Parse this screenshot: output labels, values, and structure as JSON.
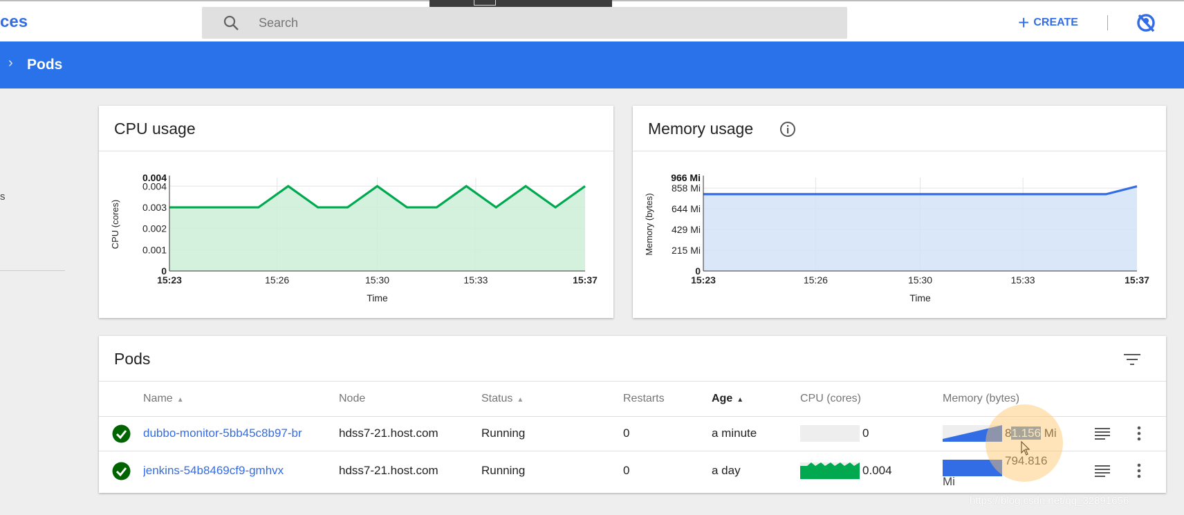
{
  "header": {
    "title_fragment": "ces",
    "search_placeholder": "Search",
    "create_label": "CREATE",
    "icons": {
      "search": "search-icon",
      "create": "plus-icon",
      "user": "account-off-icon"
    }
  },
  "breadcrumb": {
    "current": "Pods"
  },
  "sidebar": {
    "fragment": "s"
  },
  "colors": {
    "brand": "#326de6",
    "bar": "#2a72e9",
    "cpu": "#00a94f",
    "memory": "#326de6",
    "ok": "#006400"
  },
  "chart_data": [
    {
      "type": "area",
      "title": "CPU usage",
      "xlabel": "Time",
      "ylabel": "CPU (cores)",
      "x": [
        "15:23",
        "15:24",
        "15:25",
        "15:26",
        "15:27",
        "15:28",
        "15:29",
        "15:30",
        "15:31",
        "15:32",
        "15:33",
        "15:34",
        "15:35",
        "15:36",
        "15:37"
      ],
      "values": [
        0.003,
        0.003,
        0.003,
        0.003,
        0.004,
        0.003,
        0.003,
        0.004,
        0.003,
        0.003,
        0.004,
        0.003,
        0.004,
        0.003,
        0.004
      ],
      "x_ticks": [
        "15:23",
        "15:26",
        "15:30",
        "15:33",
        "15:37"
      ],
      "y_ticks": [
        "0",
        "0.001",
        "0.002",
        "0.003",
        "0.004"
      ],
      "y_tick_values": [
        0,
        0.001,
        0.002,
        0.003,
        0.004
      ],
      "y_max_label": "0.004",
      "ylim": [
        0,
        0.0044
      ],
      "grid": true
    },
    {
      "type": "area",
      "title": "Memory usage",
      "xlabel": "Time",
      "ylabel": "Memory (bytes)",
      "x": [
        "15:23",
        "15:24",
        "15:25",
        "15:26",
        "15:27",
        "15:28",
        "15:29",
        "15:30",
        "15:31",
        "15:32",
        "15:33",
        "15:34",
        "15:35",
        "15:36",
        "15:37"
      ],
      "values": [
        795,
        795,
        795,
        795,
        795,
        795,
        795,
        795,
        795,
        795,
        795,
        795,
        795,
        795,
        876
      ],
      "unit": "Mi",
      "x_ticks": [
        "15:23",
        "15:26",
        "15:30",
        "15:33",
        "15:37"
      ],
      "y_ticks": [
        "0",
        "215 Mi",
        "429 Mi",
        "644 Mi",
        "858 Mi"
      ],
      "y_tick_values": [
        0,
        215,
        429,
        644,
        858
      ],
      "y_max_label": "966 Mi",
      "ylim": [
        0,
        966
      ],
      "grid": true
    }
  ],
  "pods": {
    "title": "Pods",
    "columns": [
      "Name",
      "Node",
      "Status",
      "Restarts",
      "Age",
      "CPU (cores)",
      "Memory (bytes)"
    ],
    "sorted_column": "Age",
    "rows": [
      {
        "name": "dubbo-monitor-5bb45c8b97-br",
        "node": "hdss7-21.host.com",
        "status": "Running",
        "restarts": "0",
        "age": "a minute",
        "cpu": "0",
        "mem_prefix": "8",
        "mem_sel": "1.156",
        "mem_unit": "Mi",
        "mem": "81.156 Mi"
      },
      {
        "name": "jenkins-54b8469cf9-gmhvx",
        "node": "hdss7-21.host.com",
        "status": "Running",
        "restarts": "0",
        "age": "a day",
        "cpu": "0.004",
        "mem_prefix": "794.816",
        "mem_sel": "",
        "mem_unit": "Mi",
        "mem": "794.816 Mi"
      }
    ]
  },
  "watermark": "https://blog.csdn.net/qq_32891656"
}
